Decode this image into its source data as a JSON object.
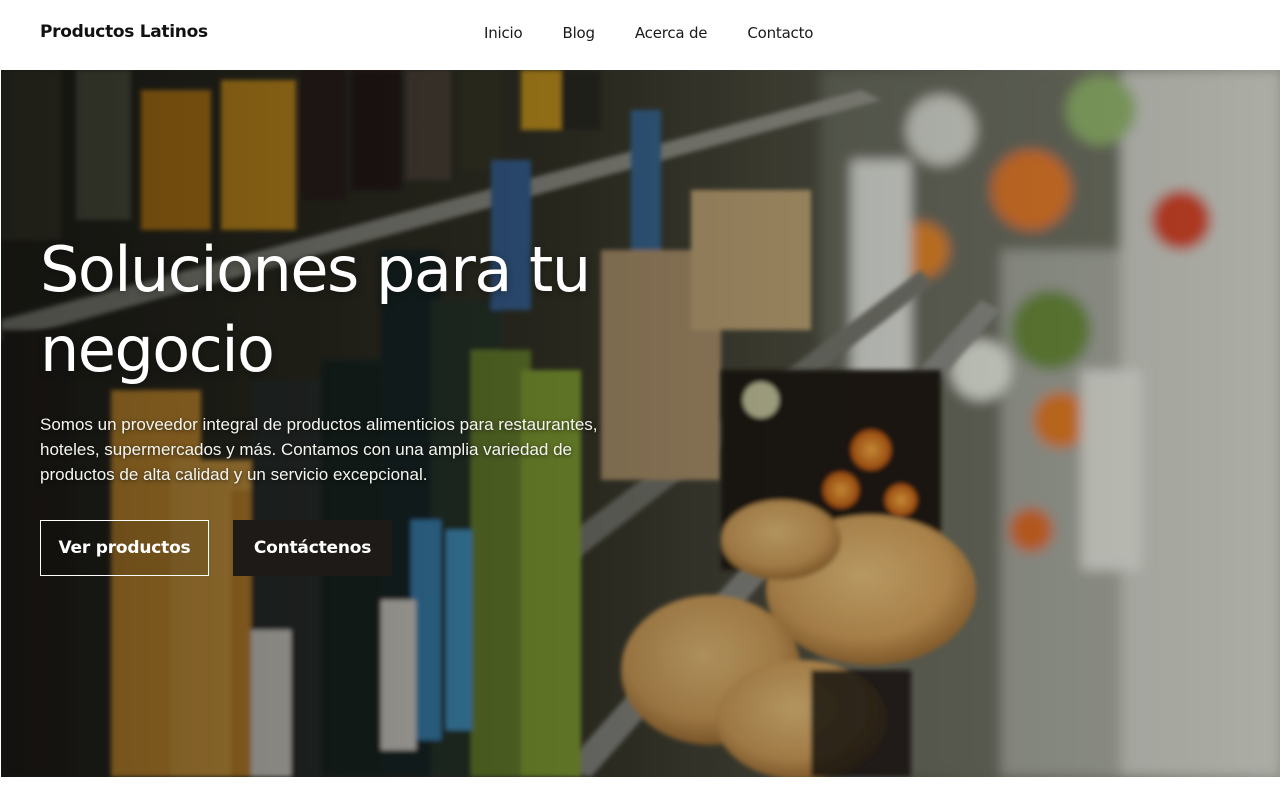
{
  "header": {
    "brand": "Productos Latinos",
    "nav": [
      "Inicio",
      "Blog",
      "Acerca de",
      "Contacto"
    ]
  },
  "hero": {
    "title_line1": "Soluciones para tu",
    "title_line2": "negocio",
    "description": "Somos un proveedor integral de productos alimenticios para restaurantes, hoteles, supermercados y más. Contamos con una amplia variedad de productos de alta calidad y un servicio excepcional.",
    "buttons": {
      "primary": "Ver productos",
      "secondary": "Contáctenos"
    },
    "image_icon": "grocery-shelf-photo"
  },
  "colors": {
    "header_bg": "#ffffff",
    "text_dark": "#111111",
    "button_dark": "#1e1a18",
    "hero_text": "#ffffff"
  }
}
